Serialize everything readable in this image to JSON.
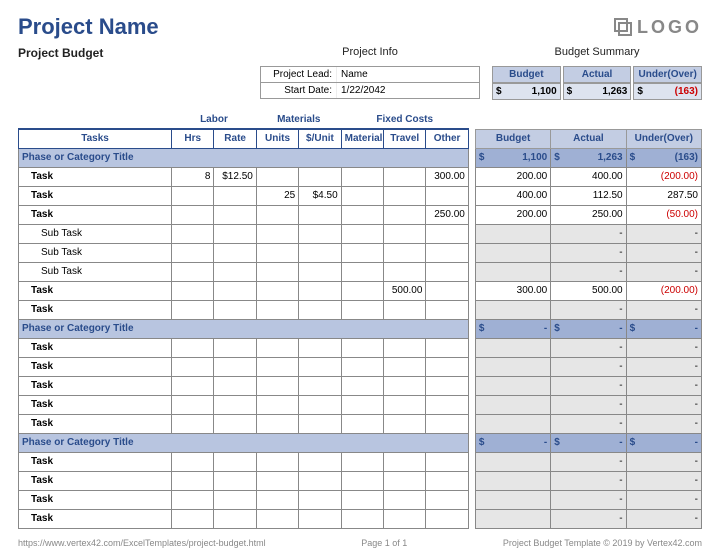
{
  "title": "Project Name",
  "subtitle": "Project Budget",
  "logo_text": "LOGO",
  "project_info": {
    "heading": "Project Info",
    "lead_label": "Project Lead:",
    "lead_value": "Name",
    "date_label": "Start Date:",
    "date_value": "1/22/2042"
  },
  "summary": {
    "heading": "Budget Summary",
    "cols": [
      "Budget",
      "Actual",
      "Under(Over)"
    ],
    "currency": "$",
    "values": [
      "1,100",
      "1,263",
      "(163)"
    ]
  },
  "groups": {
    "labor": "Labor",
    "materials": "Materials",
    "fixed": "Fixed Costs"
  },
  "cols": {
    "tasks": "Tasks",
    "hrs": "Hrs",
    "rate": "Rate",
    "units": "Units",
    "unitcost": "$/Unit",
    "material": "Material",
    "travel": "Travel",
    "other": "Other",
    "budget": "Budget",
    "actual": "Actual",
    "under": "Under(Over)"
  },
  "phases": [
    {
      "title": "Phase or Category Title",
      "budget": "1,100",
      "actual": "1,263",
      "under": "(163)",
      "rows": [
        {
          "t": "Task",
          "sub": false,
          "hrs": "8",
          "rate": "$12.50",
          "units": "",
          "uc": "",
          "mat": "",
          "trav": "",
          "oth": "300.00",
          "b": "200.00",
          "a": "400.00",
          "u": "(200.00)"
        },
        {
          "t": "Task",
          "sub": false,
          "hrs": "",
          "rate": "",
          "units": "25",
          "uc": "$4.50",
          "mat": "",
          "trav": "",
          "oth": "",
          "b": "400.00",
          "a": "112.50",
          "u": "287.50"
        },
        {
          "t": "Task",
          "sub": false,
          "hrs": "",
          "rate": "",
          "units": "",
          "uc": "",
          "mat": "",
          "trav": "",
          "oth": "250.00",
          "b": "200.00",
          "a": "250.00",
          "u": "(50.00)"
        },
        {
          "t": "Sub Task",
          "sub": true,
          "hrs": "",
          "rate": "",
          "units": "",
          "uc": "",
          "mat": "",
          "trav": "",
          "oth": "",
          "b": "",
          "a": "-",
          "u": "-"
        },
        {
          "t": "Sub Task",
          "sub": true,
          "hrs": "",
          "rate": "",
          "units": "",
          "uc": "",
          "mat": "",
          "trav": "",
          "oth": "",
          "b": "",
          "a": "-",
          "u": "-"
        },
        {
          "t": "Sub Task",
          "sub": true,
          "hrs": "",
          "rate": "",
          "units": "",
          "uc": "",
          "mat": "",
          "trav": "",
          "oth": "",
          "b": "",
          "a": "-",
          "u": "-"
        },
        {
          "t": "Task",
          "sub": false,
          "hrs": "",
          "rate": "",
          "units": "",
          "uc": "",
          "mat": "",
          "trav": "500.00",
          "oth": "",
          "b": "300.00",
          "a": "500.00",
          "u": "(200.00)"
        },
        {
          "t": "Task",
          "sub": false,
          "hrs": "",
          "rate": "",
          "units": "",
          "uc": "",
          "mat": "",
          "trav": "",
          "oth": "",
          "b": "",
          "a": "-",
          "u": "-"
        }
      ]
    },
    {
      "title": "Phase or Category Title",
      "budget": "-",
      "actual": "-",
      "under": "-",
      "rows": [
        {
          "t": "Task",
          "sub": false,
          "hrs": "",
          "rate": "",
          "units": "",
          "uc": "",
          "mat": "",
          "trav": "",
          "oth": "",
          "b": "",
          "a": "-",
          "u": "-"
        },
        {
          "t": "Task",
          "sub": false,
          "hrs": "",
          "rate": "",
          "units": "",
          "uc": "",
          "mat": "",
          "trav": "",
          "oth": "",
          "b": "",
          "a": "-",
          "u": "-"
        },
        {
          "t": "Task",
          "sub": false,
          "hrs": "",
          "rate": "",
          "units": "",
          "uc": "",
          "mat": "",
          "trav": "",
          "oth": "",
          "b": "",
          "a": "-",
          "u": "-"
        },
        {
          "t": "Task",
          "sub": false,
          "hrs": "",
          "rate": "",
          "units": "",
          "uc": "",
          "mat": "",
          "trav": "",
          "oth": "",
          "b": "",
          "a": "-",
          "u": "-"
        },
        {
          "t": "Task",
          "sub": false,
          "hrs": "",
          "rate": "",
          "units": "",
          "uc": "",
          "mat": "",
          "trav": "",
          "oth": "",
          "b": "",
          "a": "-",
          "u": "-"
        }
      ]
    },
    {
      "title": "Phase or Category Title",
      "budget": "-",
      "actual": "-",
      "under": "-",
      "rows": [
        {
          "t": "Task",
          "sub": false,
          "hrs": "",
          "rate": "",
          "units": "",
          "uc": "",
          "mat": "",
          "trav": "",
          "oth": "",
          "b": "",
          "a": "-",
          "u": "-"
        },
        {
          "t": "Task",
          "sub": false,
          "hrs": "",
          "rate": "",
          "units": "",
          "uc": "",
          "mat": "",
          "trav": "",
          "oth": "",
          "b": "",
          "a": "-",
          "u": "-"
        },
        {
          "t": "Task",
          "sub": false,
          "hrs": "",
          "rate": "",
          "units": "",
          "uc": "",
          "mat": "",
          "trav": "",
          "oth": "",
          "b": "",
          "a": "-",
          "u": "-"
        },
        {
          "t": "Task",
          "sub": false,
          "hrs": "",
          "rate": "",
          "units": "",
          "uc": "",
          "mat": "",
          "trav": "",
          "oth": "",
          "b": "",
          "a": "-",
          "u": "-"
        }
      ]
    }
  ],
  "footer": {
    "url": "https://www.vertex42.com/ExcelTemplates/project-budget.html",
    "page": "Page 1 of 1",
    "copyright": "Project Budget Template © 2019 by Vertex42.com"
  }
}
